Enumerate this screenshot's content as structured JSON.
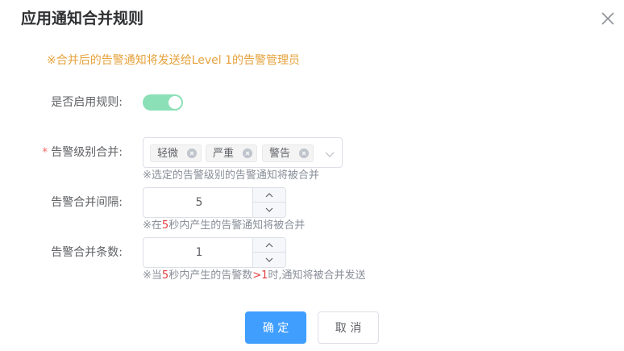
{
  "dialog": {
    "title": "应用通知合并规则"
  },
  "notice": "※合并后的告警通知将发送给Level 1的告警管理员",
  "enable_rule": {
    "label": "是否启用规则:",
    "enabled": true
  },
  "alarm_level": {
    "required_mark": "*",
    "label": "告警级别合并:",
    "tags": [
      "轻微",
      "严重",
      "警告"
    ],
    "hint": "※选定的告警级别的告警通知将被合并"
  },
  "merge_interval": {
    "label": "告警合并间隔:",
    "value": "5",
    "hint_pre": "※在",
    "hint_num": "5",
    "hint_post": "秒内产生的告警通知将被合并"
  },
  "merge_count": {
    "label": "告警合并条数:",
    "value": "1",
    "hint_pre": "※当",
    "hint_num": "5",
    "hint_mid": "秒内产生的告警数",
    "hint_num2": ">1",
    "hint_post": "时,通知将被合并发送"
  },
  "buttons": {
    "confirm": "确 定",
    "cancel": "取 消"
  },
  "colors": {
    "primary": "#409eff",
    "warning": "#e6a23c",
    "switch_on": "#8be0b7",
    "danger": "#e5393b"
  },
  "icons": {
    "close": "close-icon",
    "tag_remove": "circle-x-icon",
    "dropdown": "chevron-down-icon",
    "increase": "chevron-up-icon",
    "decrease": "chevron-down-icon"
  }
}
